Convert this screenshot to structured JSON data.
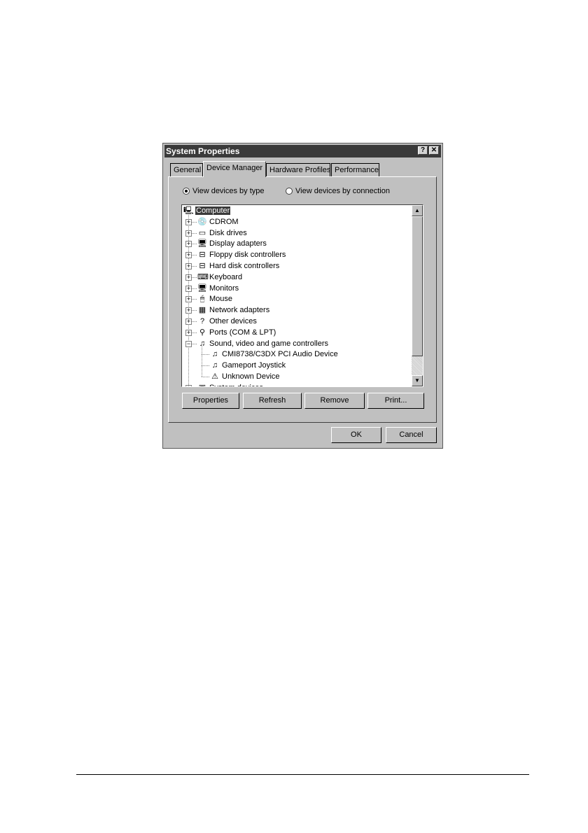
{
  "window": {
    "title": "System Properties",
    "help_label": "?",
    "close_label": "✕"
  },
  "tabs": [
    {
      "label": "General"
    },
    {
      "label": "Device Manager"
    },
    {
      "label": "Hardware Profiles"
    },
    {
      "label": "Performance"
    }
  ],
  "view_options": {
    "by_type": "View devices by type",
    "by_connection": "View devices by connection",
    "selected": "by_type"
  },
  "tree": {
    "root": "Computer",
    "items": [
      {
        "label": "CDROM",
        "icon": "cdrom-icon",
        "glyph": "💿",
        "expanded": false
      },
      {
        "label": "Disk drives",
        "icon": "disk-drive-icon",
        "glyph": "▭",
        "expanded": false
      },
      {
        "label": "Display adapters",
        "icon": "display-adapter-icon",
        "glyph": "🖥",
        "expanded": false
      },
      {
        "label": "Floppy disk controllers",
        "icon": "floppy-controller-icon",
        "glyph": "⊟",
        "expanded": false
      },
      {
        "label": "Hard disk controllers",
        "icon": "hard-disk-controller-icon",
        "glyph": "⊟",
        "expanded": false
      },
      {
        "label": "Keyboard",
        "icon": "keyboard-icon",
        "glyph": "⌨",
        "expanded": false
      },
      {
        "label": "Monitors",
        "icon": "monitor-icon",
        "glyph": "🖥",
        "expanded": false
      },
      {
        "label": "Mouse",
        "icon": "mouse-icon",
        "glyph": "🖱",
        "expanded": false
      },
      {
        "label": "Network adapters",
        "icon": "network-adapter-icon",
        "glyph": "▦",
        "expanded": false
      },
      {
        "label": "Other devices",
        "icon": "question-icon",
        "glyph": "?",
        "expanded": false
      },
      {
        "label": "Ports (COM & LPT)",
        "icon": "port-icon",
        "glyph": "⚲",
        "expanded": false
      },
      {
        "label": "Sound, video and game controllers",
        "icon": "sound-icon",
        "glyph": "♫",
        "expanded": true,
        "children": [
          {
            "label": "CMI8738/C3DX PCI Audio Device",
            "icon": "audio-device-icon",
            "glyph": "♫"
          },
          {
            "label": "Gameport Joystick",
            "icon": "joystick-icon",
            "glyph": "♫"
          },
          {
            "label": "Unknown Device",
            "icon": "unknown-device-icon",
            "glyph": "⚠"
          }
        ]
      },
      {
        "label": "System devices",
        "icon": "system-device-icon",
        "glyph": "▣",
        "expanded": false
      }
    ]
  },
  "buttons": {
    "properties": "Properties",
    "refresh": "Refresh",
    "remove": "Remove",
    "print": "Print...",
    "ok": "OK",
    "cancel": "Cancel"
  }
}
